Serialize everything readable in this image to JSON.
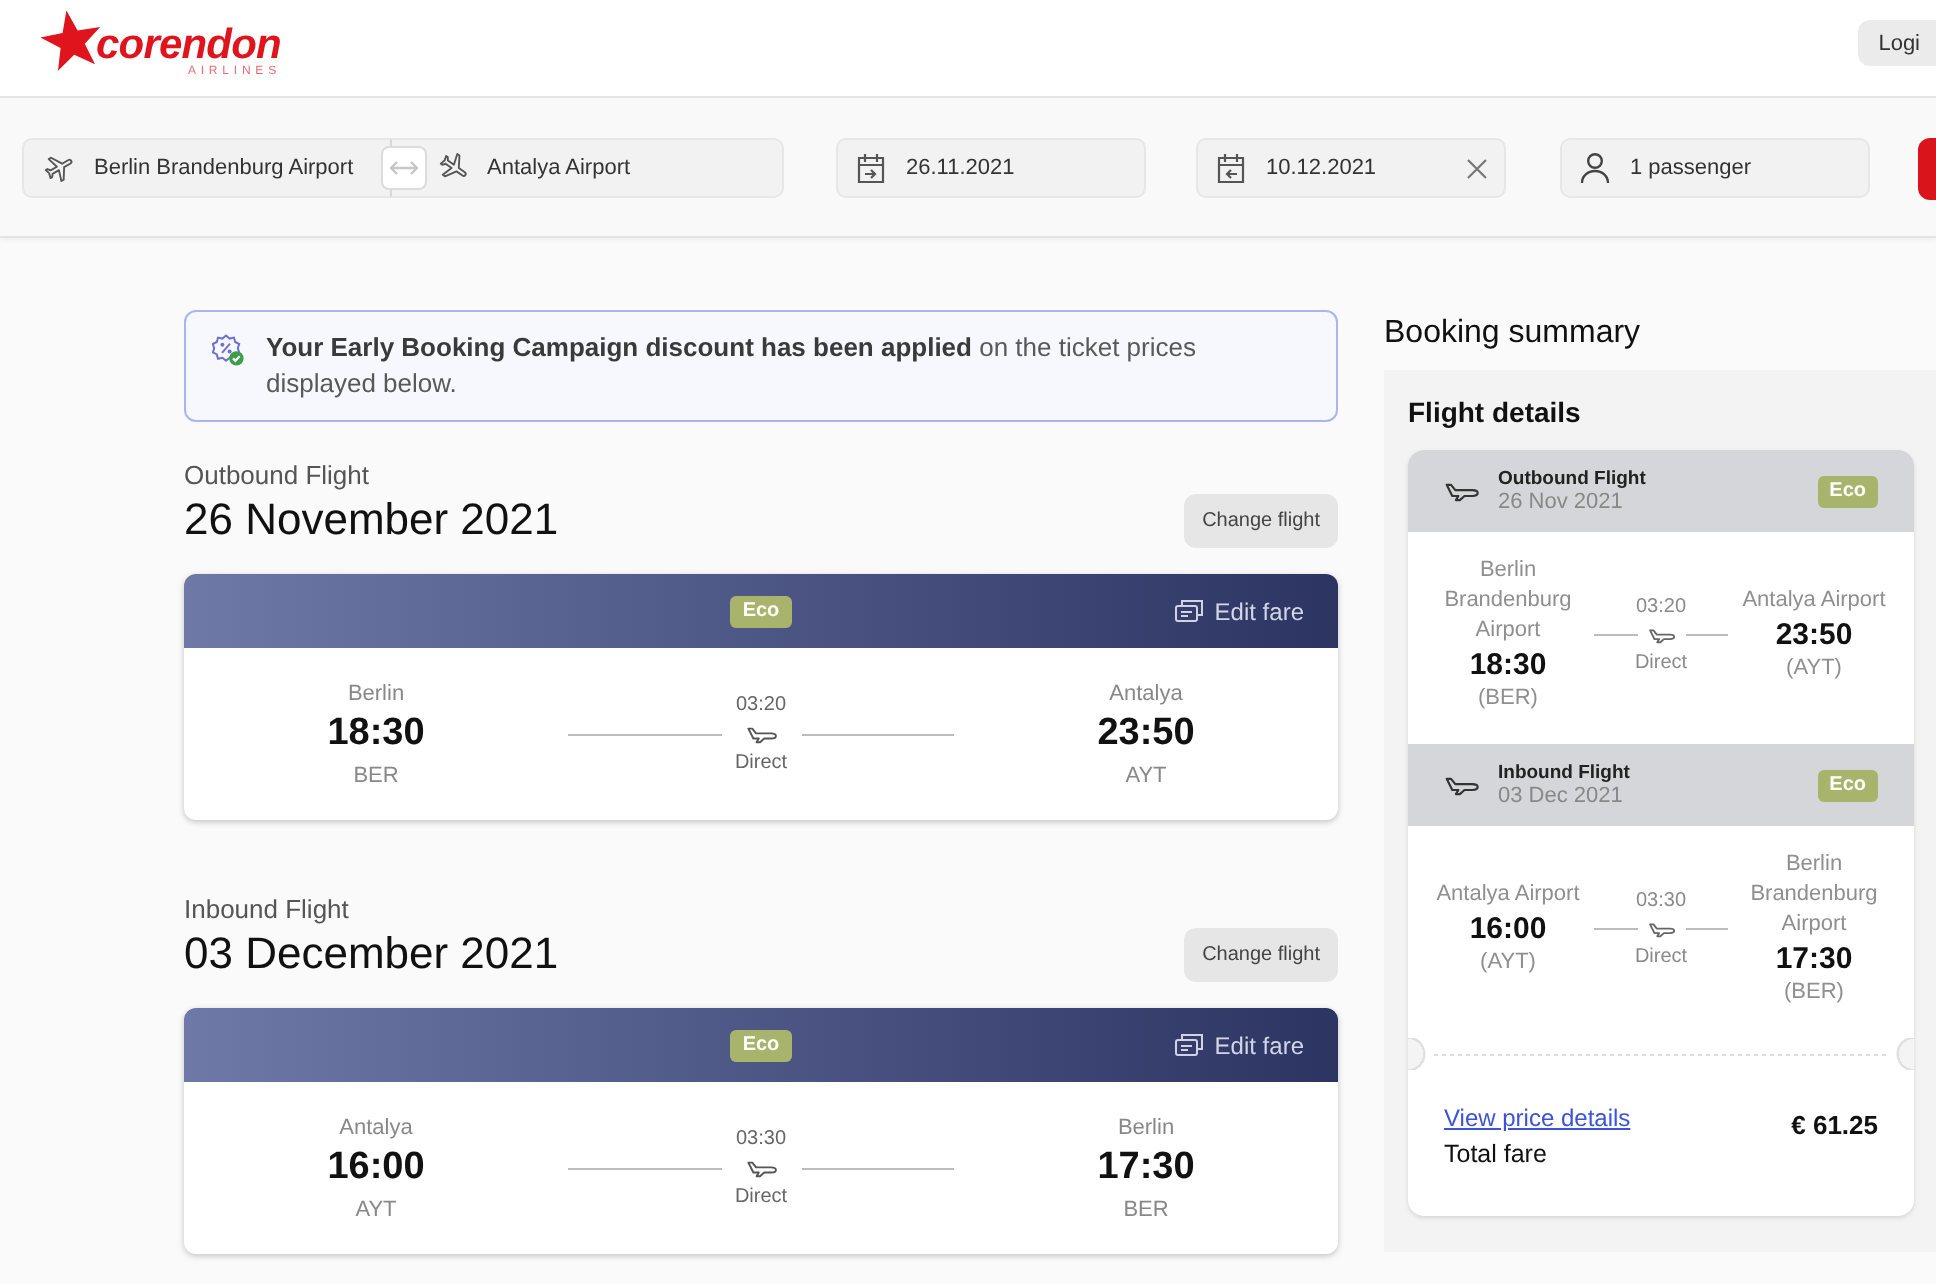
{
  "header": {
    "logo": {
      "wordmark": "corendon",
      "tagline": "AIRLINES"
    },
    "login_button": "Logi"
  },
  "search_bar": {
    "origin": "Berlin Brandenburg Airport",
    "destination": "Antalya Airport",
    "departure_date": "26.11.2021",
    "return_date": "10.12.2021",
    "passengers": "1 passenger"
  },
  "notice": {
    "text": "**Your Early Booking Campaign discount has been applied** on the ticket prices displayed below."
  },
  "flights": [
    {
      "direction": "Outbound Flight",
      "date": "26 November 2021",
      "change_button": "Change flight",
      "fare": "Eco",
      "edit_fare": "Edit fare",
      "departure": {
        "city": "Berlin",
        "time": "18:30",
        "code": "BER"
      },
      "duration": "03:20",
      "stops": "Direct",
      "arrival": {
        "city": "Antalya",
        "time": "23:50",
        "code": "AYT"
      }
    },
    {
      "direction": "Inbound Flight",
      "date": "03 December 2021",
      "change_button": "Change flight",
      "fare": "Eco",
      "edit_fare": "Edit fare",
      "departure": {
        "city": "Antalya",
        "time": "16:00",
        "code": "AYT"
      },
      "duration": "03:30",
      "stops": "Direct",
      "arrival": {
        "city": "Berlin",
        "time": "17:30",
        "code": "BER"
      }
    }
  ],
  "booking_summary": {
    "title": "Booking summary",
    "section_title": "Flight details",
    "segments": [
      {
        "label": "Outbound Flight",
        "date": "26 Nov 2021",
        "fare": "Eco",
        "departure": {
          "airport": "Berlin Brandenburg Airport",
          "time": "18:30",
          "code": "(BER)"
        },
        "duration": "03:20",
        "stops": "Direct",
        "arrival": {
          "airport": "Antalya Airport",
          "time": "23:50",
          "code": "(AYT)"
        }
      },
      {
        "label": "Inbound Flight",
        "date": "03 Dec 2021",
        "fare": "Eco",
        "departure": {
          "airport": "Antalya Airport",
          "time": "16:00",
          "code": "(AYT)"
        },
        "duration": "03:30",
        "stops": "Direct",
        "arrival": {
          "airport": "Berlin Brandenburg Airport",
          "time": "17:30",
          "code": "(BER)"
        }
      }
    ],
    "price_details_link": "View price details",
    "total_label": "Total fare",
    "total": "€ 61.25"
  }
}
